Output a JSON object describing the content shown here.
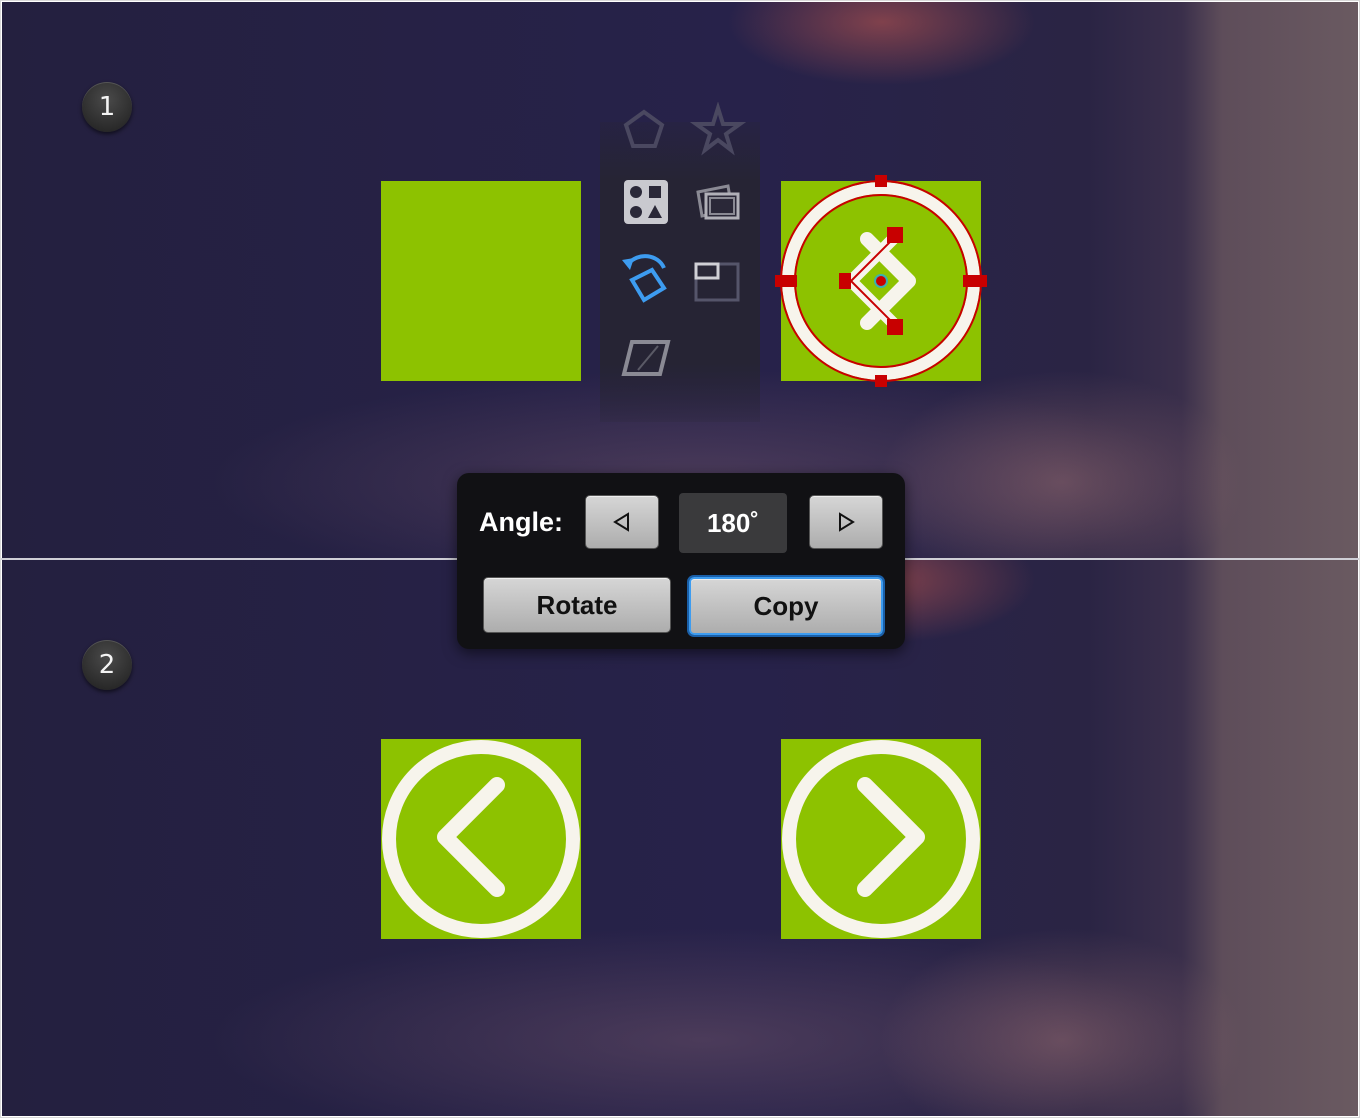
{
  "steps": [
    {
      "number": "1"
    },
    {
      "number": "2"
    }
  ],
  "toolbar": {
    "tools": [
      "pentagon-icon",
      "star-icon",
      "shapes-library-icon",
      "transform-each-icon",
      "rotate-icon",
      "scale-icon",
      "shear-icon"
    ]
  },
  "rotate_dialog": {
    "angle_label": "Angle:",
    "angle_value": "180˚",
    "decrease_icon": "left-triangle-icon",
    "increase_icon": "right-triangle-icon",
    "rotate_label": "Rotate",
    "copy_label": "Copy"
  },
  "colors": {
    "square_fill": "#8dc200",
    "stroke": "#f7f4ec",
    "selection": "#c80000",
    "accent_blue": "#3d9cf0"
  }
}
